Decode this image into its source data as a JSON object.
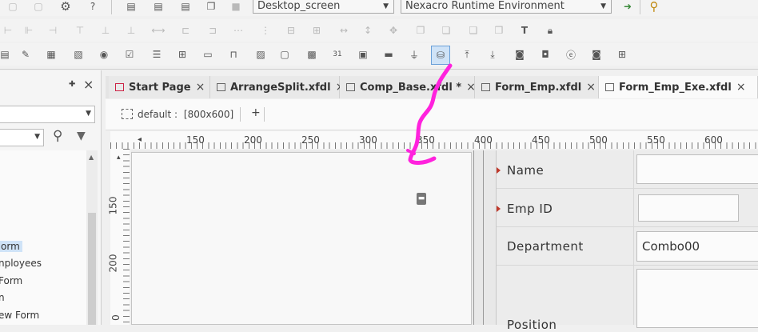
{
  "toolbar": {
    "screen_select": "Desktop_screen",
    "environment_select": "Nexacro Runtime Environment"
  },
  "tabs": [
    {
      "label": "Start Page",
      "active": false
    },
    {
      "label": "ArrangeSplit.xfdl",
      "active": false
    },
    {
      "label": "Comp_Base.xfdl *",
      "active": false
    },
    {
      "label": "Form_Emp.xfdl",
      "active": false
    },
    {
      "label": "Form_Emp_Exe.xfdl",
      "active": true
    }
  ],
  "tab_close_glyph": "×",
  "panel": {
    "pin_glyph": "✚",
    "close_glyph": "×",
    "tree_items": [
      "orm",
      "nployees",
      "Form",
      "n",
      "ew Form"
    ]
  },
  "design": {
    "layout_label": "default :",
    "layout_size": "[800x600]",
    "add_layout": "+",
    "ruler_h": [
      "150",
      "200",
      "250",
      "300",
      "350",
      "400",
      "450",
      "500",
      "550",
      "600"
    ],
    "ruler_v": [
      "150",
      "200",
      "0"
    ]
  },
  "form": {
    "name_label": "Name",
    "empid_label": "Emp ID",
    "department_label": "Department",
    "department_value": "Combo00",
    "position_label": "Position"
  },
  "colors": {
    "annotation": "#ff22dd",
    "required": "#c0392b"
  },
  "icons": [
    "new-icon",
    "open-icon",
    "gear-icon",
    "help-icon",
    "run-icon",
    "search-icon",
    "lock-icon",
    "dataset-icon"
  ]
}
